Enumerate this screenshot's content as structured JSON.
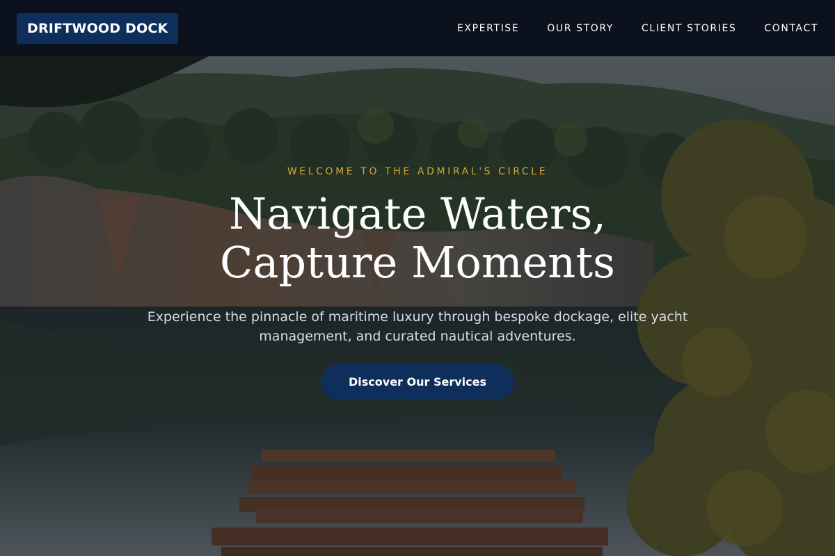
{
  "header": {
    "logo": "DRIFTWOOD DOCK",
    "nav": [
      {
        "label": "EXPERTISE"
      },
      {
        "label": "OUR STORY"
      },
      {
        "label": "CLIENT STORIES"
      },
      {
        "label": "CONTACT"
      }
    ]
  },
  "hero": {
    "eyebrow": "WELCOME TO THE ADMIRAL'S CIRCLE",
    "headline": "Navigate Waters, Capture Moments",
    "subtitle": "Experience the pinnacle of maritime luxury through bespoke dockage, elite yacht management, and curated nautical adventures.",
    "cta_label": "Discover Our Services",
    "background_image": "lake-with-wooden-dock-and-forest"
  },
  "colors": {
    "header_bg": "#0b111d",
    "brand_navy": "#0e2f5c",
    "accent_gold": "#d6a72c"
  }
}
